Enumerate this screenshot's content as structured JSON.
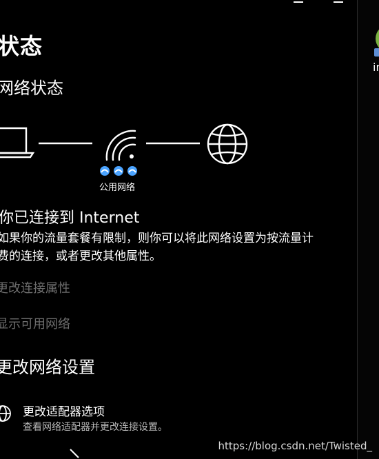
{
  "page": {
    "title": "状态",
    "section_network_status": "网络状态"
  },
  "diagram": {
    "network_label": "公用网络"
  },
  "status": {
    "connected_title": "你已连接到 Internet",
    "description_lines": [
      "如果你的流量套餐有限制，则你可以将此网络设置为按流量计",
      "费的连接，或者更改其他属性。"
    ]
  },
  "links": {
    "change_properties": "更改连接属性",
    "show_networks": "显示可用网络"
  },
  "change_settings": {
    "title": "更改网络设置",
    "adapter_title": "更改适配器选项",
    "adapter_desc": "查看网络适配器并更改连接设置。"
  },
  "right_strip": {
    "app_label": "in"
  },
  "watermark": "https://blog.csdn.net/Twisted_",
  "colors": {
    "background": "#000000",
    "text": "#ffffff",
    "dim_link": "#6d6d6d",
    "secondary": "#b8b8b8",
    "badge_blue": "#4aa3ff"
  },
  "icons": {
    "laptop": "laptop-icon",
    "wifi": "wifi-icon",
    "globe": "globe-icon",
    "adapter": "globe-adapter-icon"
  }
}
